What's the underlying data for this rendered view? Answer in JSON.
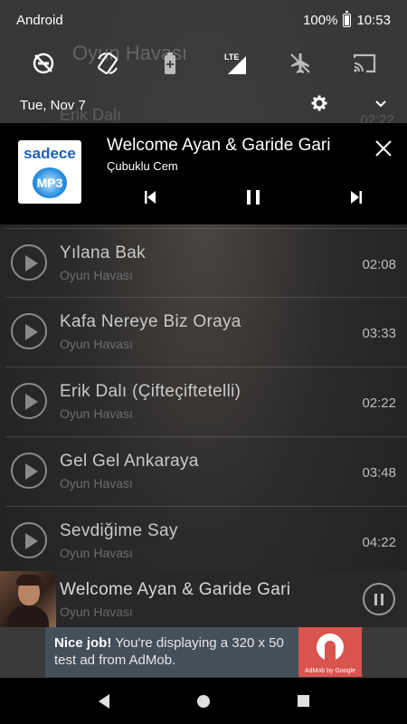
{
  "status_bar": {
    "carrier": "Android",
    "battery": "100%",
    "time": "10:53"
  },
  "quick_settings": {
    "tiles": [
      "dnd-off-icon",
      "auto-rotate-icon",
      "battery-saver-icon",
      "lte-signal-icon",
      "airplane-mode-icon",
      "cast-icon"
    ],
    "lte_label": "LTE"
  },
  "ghost": {
    "title": "Oyun Havası",
    "row": "Erik Dalı",
    "time": "02:22"
  },
  "date_row": {
    "date": "Tue, Nov 7"
  },
  "media_notification": {
    "title": "Welcome Ayan & Garide Gari",
    "artist": "Çubuklu Cem",
    "album_brand": "sadece",
    "album_disc": "MP3"
  },
  "songs": [
    {
      "title": "Yılana Bak",
      "subtitle": "Oyun Havası",
      "duration": "02:08"
    },
    {
      "title": "Kafa Nereye Biz Oraya",
      "subtitle": "Oyun Havası",
      "duration": "03:33"
    },
    {
      "title": "Erik Dalı (Çifteçiftetelli)",
      "subtitle": "Oyun Havası",
      "duration": "02:22"
    },
    {
      "title": "Gel Gel Ankaraya",
      "subtitle": "Oyun Havası",
      "duration": "03:48"
    },
    {
      "title": "Sevdiğime Say",
      "subtitle": "Oyun Havası",
      "duration": "04:22"
    }
  ],
  "now_playing": {
    "title": "Welcome Ayan & Garide Gari",
    "subtitle": "Oyun Havası"
  },
  "ad": {
    "bold": "Nice job!",
    "text": " You're displaying a 320 x 50 test ad from AdMob.",
    "logo_text": "AdMob by Google"
  },
  "colors": {
    "shade": "#000000",
    "ad_bg": "#43505a",
    "ad_logo": "#d9534f",
    "album_blue": "#1f5fb8"
  }
}
